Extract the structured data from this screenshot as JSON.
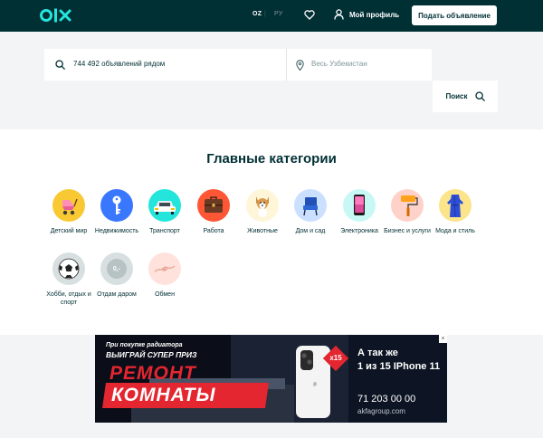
{
  "header": {
    "lang_active": "OZ",
    "lang_inactive": "РУ",
    "lang_separator": "|",
    "profile_label": "Мой профиль",
    "post_button_label": "Подать объявление"
  },
  "search": {
    "query_placeholder": "744 492 объявлений рядом",
    "location_value": "Весь Узбекистан",
    "button_label": "Поиск"
  },
  "categories": {
    "title": "Главные категории",
    "items": [
      {
        "label": "Детский мир",
        "color": "#f9c934",
        "icon": "stroller-icon"
      },
      {
        "label": "Недвижимость",
        "color": "#3a77ff",
        "icon": "key-icon"
      },
      {
        "label": "Транспорт",
        "color": "#23e5db",
        "icon": "car-icon"
      },
      {
        "label": "Работа",
        "color": "#ff5636",
        "icon": "briefcase-icon"
      },
      {
        "label": "Животные",
        "color": "#fff6d9",
        "icon": "dog-icon"
      },
      {
        "label": "Дом и сад",
        "color": "#cbdfff",
        "icon": "chair-icon"
      },
      {
        "label": "Электроника",
        "color": "#c8f8f6",
        "icon": "phone-icon"
      },
      {
        "label": "Бизнес и услуги",
        "color": "#ffd2c9",
        "icon": "paint-roller-icon"
      },
      {
        "label": "Мода и стиль",
        "color": "#fce48b",
        "icon": "dress-icon"
      },
      {
        "label": "Хобби, отдых и спорт",
        "color": "#d8dfe0",
        "icon": "soccer-ball-icon"
      },
      {
        "label": "Отдам даром",
        "color": "#d8dfe0",
        "icon": "free-coin-icon"
      },
      {
        "label": "Обмен",
        "color": "#ffe2dc",
        "icon": "exchange-hands-icon"
      }
    ],
    "free_coin_text": "0,-"
  },
  "banner": {
    "promo_line1": "При покупке радиатора",
    "promo_line2": "ВЫИГРАЙ СУПЕР ПРИЗ",
    "headline1": "РЕМОНТ",
    "headline2": "КОМНАТЫ",
    "badge": "x15",
    "right_line1": "А так же",
    "right_line2": "1 из 15 IPhone 11",
    "phone": "71 203 00 00",
    "site": "akfagroup.com",
    "close": "×"
  },
  "colors": {
    "header_bg": "#002f34",
    "teal_accent": "#23e5db",
    "page_gray": "#f2f4f5",
    "banner_red": "#e3262f"
  }
}
